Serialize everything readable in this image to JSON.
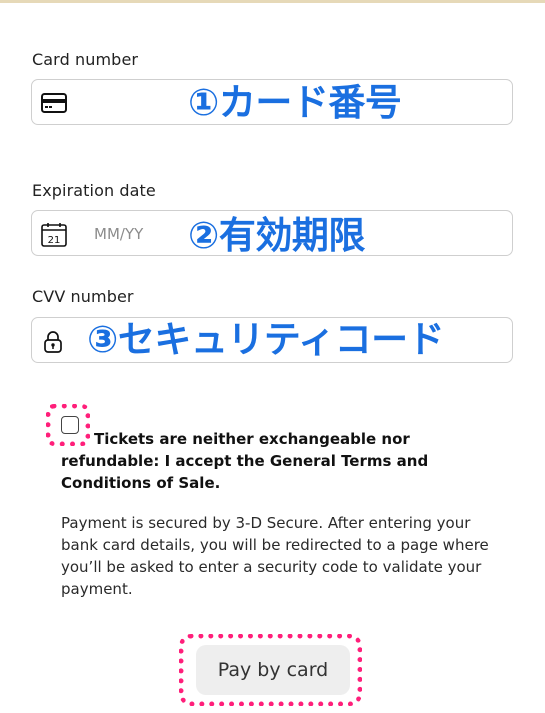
{
  "card_number": {
    "label": "Card number",
    "icon": "credit-card-icon",
    "annotation": "①カード番号"
  },
  "expiration_date": {
    "label": "Expiration date",
    "icon": "calendar-icon",
    "calendar_day": "21",
    "placeholder": "MM/YY",
    "annotation": "②有効期限"
  },
  "cvv": {
    "label": "CVV number",
    "icon": "lock-icon",
    "annotation": "③セキュリティコード"
  },
  "terms": {
    "text": "Tickets are neither exchangeable nor refundable: I accept the General Terms and Conditions of Sale.",
    "checked": false
  },
  "secure_note": "Payment is secured by 3-D Secure. After entering your bank card details, you will be redirected to a page where you’ll be asked to enter a security code to validate your payment.",
  "pay_button": {
    "label": "Pay by card"
  },
  "colors": {
    "annotation": "#1a6fe0",
    "highlight_dots": "#ff1f7a",
    "top_rule": "#e6d9b8"
  }
}
